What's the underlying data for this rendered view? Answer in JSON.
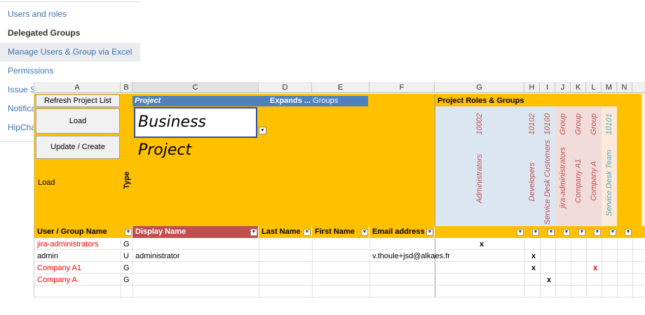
{
  "nav": {
    "items": [
      {
        "label": "Users and roles",
        "state": "link"
      },
      {
        "label": "Delegated Groups",
        "state": "current"
      },
      {
        "label": "Manage Users & Group via Excel",
        "state": "selected"
      },
      {
        "label": "Permissions",
        "state": "link"
      },
      {
        "label": "Issue S",
        "state": "link"
      },
      {
        "label": "Notifica",
        "state": "link"
      },
      {
        "label": "HipCha",
        "state": "link"
      }
    ]
  },
  "sheet": {
    "columns": [
      "A",
      "B",
      "C",
      "D",
      "E",
      "F",
      "G",
      "H",
      "I",
      "J",
      "K",
      "L",
      "M",
      "N"
    ],
    "buttons": {
      "refresh": "Refresh Project List",
      "load": "Load",
      "update": "Update / Create"
    },
    "project_label": "Project",
    "expands_label": "Expands ...",
    "groups_label": "Groups",
    "roles_groups_label": "Project Roles & Groups",
    "project_value": "Business Project",
    "load_label": "Load",
    "type_label": "Type",
    "role_columns": [
      {
        "id": "10002",
        "name": "Administrators"
      },
      {
        "id": "10102",
        "name": "Developers"
      },
      {
        "id": "10100",
        "name": "Service Desk Customers"
      },
      {
        "id": "Group",
        "name": "jira-administrators"
      },
      {
        "id": "Group",
        "name": "Company A1"
      },
      {
        "id": "Group",
        "name": "Company A"
      },
      {
        "id": "10101",
        "name": "Service Desk Team"
      }
    ],
    "headers": {
      "user_group_name": "User / Group Name",
      "display_name": "Display Name",
      "last_name": "Last Name",
      "first_name": "First Name",
      "email": "Email address"
    },
    "rows": [
      {
        "name": "jira-administrators",
        "type": "G",
        "display": "",
        "email": "",
        "marks": [
          "x",
          "",
          "",
          "",
          "",
          "",
          ""
        ]
      },
      {
        "name": "admin",
        "type": "U",
        "display": "administrator",
        "email": "v.thoule+jsd@alkaes.fr",
        "marks": [
          "",
          "x",
          "",
          "",
          "",
          "",
          ""
        ]
      },
      {
        "name": "Company A1",
        "type": "G",
        "display": "",
        "email": "",
        "marks": [
          "",
          "x",
          "",
          "",
          "",
          "x",
          ""
        ]
      },
      {
        "name": "Company A",
        "type": "G",
        "display": "",
        "email": "",
        "marks": [
          "",
          "",
          "x",
          "",
          "",
          "",
          ""
        ]
      }
    ],
    "colors": {
      "yellow": "#ffc000",
      "blue": "#4f81bd",
      "dark_red": "#c0504d",
      "light_blue": "#dce6f1",
      "light_pink": "#f2dcdb",
      "light_peach": "#fde9d9",
      "group_red": "#ff0000"
    }
  }
}
